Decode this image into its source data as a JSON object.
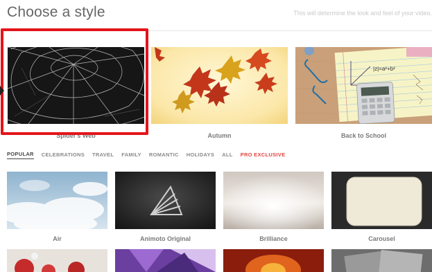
{
  "header": {
    "title": "Choose a style",
    "subtitle": "This will determine the look and feel of your video."
  },
  "featured": [
    {
      "caption": "Spider's Web"
    },
    {
      "caption": "Autumn"
    },
    {
      "caption": "Back to School"
    }
  ],
  "tabs": [
    {
      "label": "POPULAR"
    },
    {
      "label": "CELEBRATIONS"
    },
    {
      "label": "TRAVEL"
    },
    {
      "label": "FAMILY"
    },
    {
      "label": "ROMANTIC"
    },
    {
      "label": "HOLIDAYS"
    },
    {
      "label": "ALL"
    },
    {
      "label": "PRO EXCLUSIVE"
    }
  ],
  "styles": [
    {
      "caption": "Air"
    },
    {
      "caption": "Animoto Original"
    },
    {
      "caption": "Brilliance"
    },
    {
      "caption": "Carousel"
    }
  ],
  "math_note": "|z|=a²+b²",
  "colors": {
    "highlight": "#e4141b",
    "pro_tab": "#e4443f"
  }
}
